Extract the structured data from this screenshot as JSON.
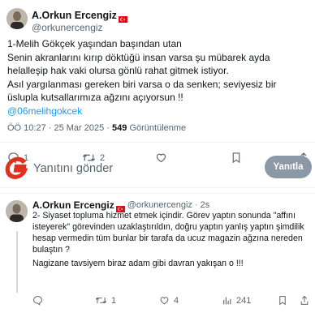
{
  "tweet": {
    "author_name": "A.Orkun Ercengiz",
    "author_handle": "@orkunercengiz",
    "lines": [
      "1-Melih Gökçek yaşından başından utan",
      "Senin akranlarını kırıp döktüğü insan varsa şu mübarek ayda helalleşip hak vaki olursa gönlü rahat gitmek istiyor.",
      "Asıl yargılanması gereken biri varsa o da senken; seviyesiz bir üslupla kutsallarımıza ağzını açıyorsun !!"
    ],
    "mention": "@06melihgokcek",
    "time": "ÖÖ 10:27 · 25 Mar 2025",
    "views_count": "549",
    "views_label": "Görüntülenme",
    "actions": {
      "reply_count": "1",
      "retweet_count": "2",
      "like_count": "",
      "bookmark_count": ""
    }
  },
  "reply_composer": {
    "placeholder": "Yanıtını gönder",
    "button_label": "Yanıtla"
  },
  "reply_tweet": {
    "author_name": "A.Orkun Ercengiz",
    "author_handle": "@orkunercengiz",
    "time": "· 2s",
    "lines": [
      "2- Siyaset topluma hizmet etmek içindir. Görev yaptın sonunda \"affını isteyerek\" görevinden uzaklaştırıldın, doğru yaptın yanlış yaptın şimdilik hesap vermedin tüm bunlar bir tarafa da ucuz magazin ağzına nereden bulaştın ?",
      "Nagizane tavsiyem biraz adam gibi davran yakışan o !!!"
    ],
    "actions": {
      "reply_count": "",
      "retweet_count": "1",
      "like_count": "4",
      "views_count": "241"
    }
  },
  "colors": {
    "accent": "#1d9bf0",
    "muted": "#536471",
    "logo_red": "#e0301e",
    "button_disabled": "#8b98a5"
  },
  "icons": [
    "avatar",
    "turkey-flag-icon",
    "reply-icon",
    "retweet-icon",
    "like-icon",
    "bookmark-icon",
    "share-icon",
    "views-icon",
    "g-logo"
  ]
}
